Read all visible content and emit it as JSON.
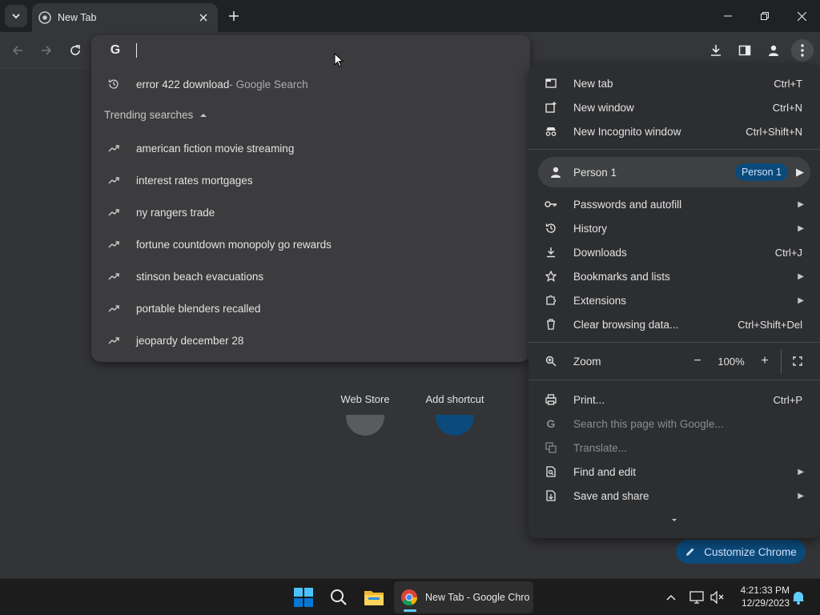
{
  "tab": {
    "title": "New Tab"
  },
  "omnibox": {
    "history_item": {
      "query": "error 422 download",
      "suffix": " - Google Search"
    },
    "trending_label": "Trending searches",
    "trending": [
      "american fiction movie streaming",
      "interest rates mortgages",
      "ny rangers trade",
      "fortune countdown monopoly go rewards",
      "stinson beach evacuations",
      "portable blenders recalled",
      "jeopardy december 28"
    ]
  },
  "shortcuts": [
    {
      "label": "Web Store"
    },
    {
      "label": "Add shortcut"
    }
  ],
  "menu": {
    "new_tab": {
      "label": "New tab",
      "shortcut": "Ctrl+T"
    },
    "new_window": {
      "label": "New window",
      "shortcut": "Ctrl+N"
    },
    "new_incognito": {
      "label": "New Incognito window",
      "shortcut": "Ctrl+Shift+N"
    },
    "person": {
      "label": "Person 1",
      "badge": "Person 1"
    },
    "passwords": {
      "label": "Passwords and autofill"
    },
    "history": {
      "label": "History"
    },
    "downloads": {
      "label": "Downloads",
      "shortcut": "Ctrl+J"
    },
    "bookmarks": {
      "label": "Bookmarks and lists"
    },
    "extensions": {
      "label": "Extensions"
    },
    "clear_data": {
      "label": "Clear browsing data...",
      "shortcut": "Ctrl+Shift+Del"
    },
    "zoom": {
      "label": "Zoom",
      "value": "100%"
    },
    "print": {
      "label": "Print...",
      "shortcut": "Ctrl+P"
    },
    "search_page": {
      "label": "Search this page with Google..."
    },
    "translate": {
      "label": "Translate..."
    },
    "find_edit": {
      "label": "Find and edit"
    },
    "save_share": {
      "label": "Save and share"
    }
  },
  "customize": {
    "label": "Customize Chrome"
  },
  "taskbar": {
    "chrome_app": "New Tab - Google Chro",
    "time": "4:21:33 PM",
    "date": "12/29/2023"
  },
  "colors": {
    "accent": "#0b4a7a",
    "menu_bg": "#2d2e30",
    "page_bg": "#333437"
  }
}
